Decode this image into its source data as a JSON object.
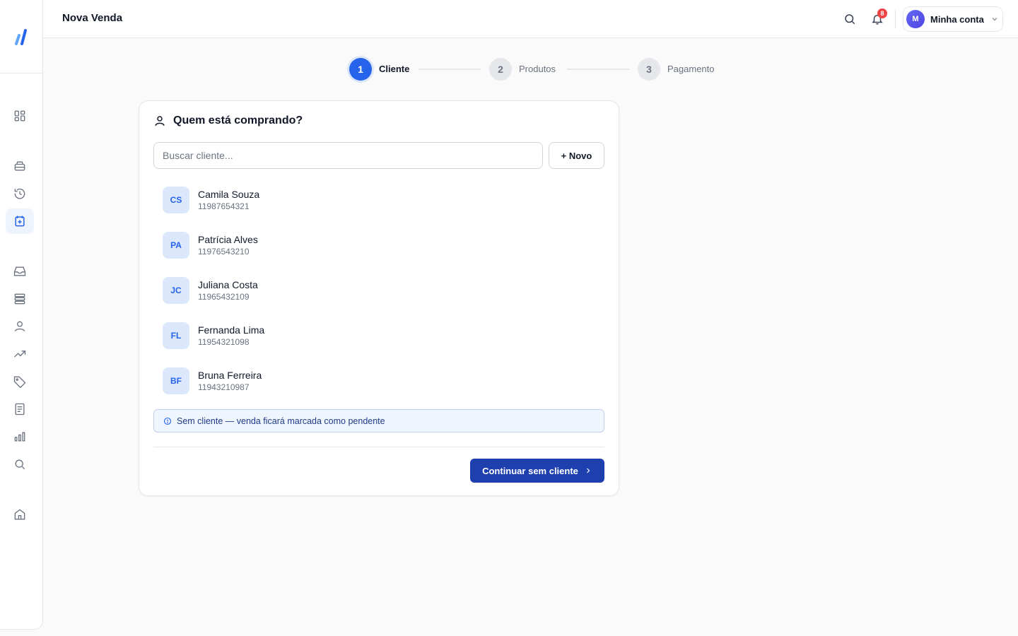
{
  "sidebar": {
    "items": [
      {
        "name": "dashboard-icon",
        "active": false
      },
      {
        "name": "register-icon",
        "active": false
      },
      {
        "name": "history-icon",
        "active": false
      },
      {
        "name": "new-sale-icon",
        "active": true
      },
      {
        "name": "inbox-icon",
        "active": false
      },
      {
        "name": "stack-icon",
        "active": false
      },
      {
        "name": "user-icon",
        "active": false
      },
      {
        "name": "trend-icon",
        "active": false
      },
      {
        "name": "tag-icon",
        "active": false
      },
      {
        "name": "document-icon",
        "active": false
      },
      {
        "name": "bar-chart-icon",
        "active": false
      },
      {
        "name": "search-icon",
        "active": false
      },
      {
        "name": "home-icon",
        "active": false
      }
    ]
  },
  "header": {
    "title": "Nova Venda",
    "notification_count": "8",
    "account": {
      "avatar_initial": "M",
      "label": "Minha conta"
    }
  },
  "stepper": {
    "steps": [
      {
        "number": "1",
        "label": "Cliente",
        "state": "active"
      },
      {
        "number": "2",
        "label": "Produtos",
        "state": "todo"
      },
      {
        "number": "3",
        "label": "Pagamento",
        "state": "todo"
      }
    ]
  },
  "card": {
    "title": "Quem está comprando?",
    "search_placeholder": "Buscar cliente...",
    "new_button_label": "+ Novo",
    "clients": [
      {
        "initials": "CS",
        "name": "Camila Souza",
        "phone": "11987654321"
      },
      {
        "initials": "PA",
        "name": "Patrícia Alves",
        "phone": "11976543210"
      },
      {
        "initials": "JC",
        "name": "Juliana Costa",
        "phone": "11965432109"
      },
      {
        "initials": "FL",
        "name": "Fernanda Lima",
        "phone": "11954321098"
      },
      {
        "initials": "BF",
        "name": "Bruna Ferreira",
        "phone": "11943210987"
      }
    ],
    "alert_text": "Sem cliente — venda ficará marcada como pendente",
    "continue_button_label": "Continuar sem cliente"
  },
  "colors": {
    "accent": "#2563eb",
    "primary_button": "#1e40af",
    "badge": "#ef4444"
  }
}
